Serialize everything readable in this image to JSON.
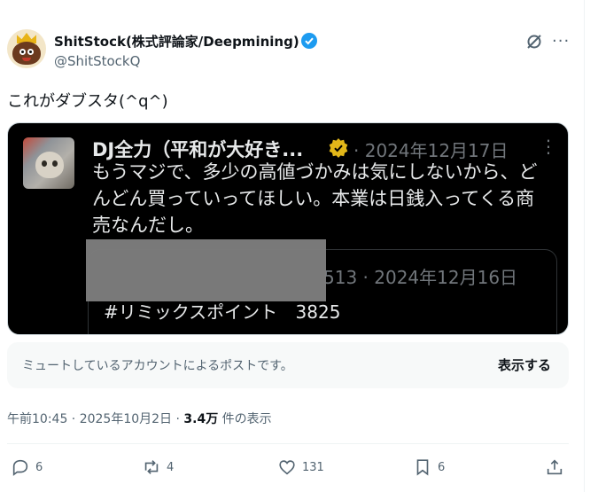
{
  "author": {
    "display_name": "ShitStock(株式評論家/Deepmining)",
    "handle": "@ShitStockQ",
    "verified": true
  },
  "tweet": {
    "text": "これがダブスタ(^q^)"
  },
  "media": {
    "inner_post": {
      "author": "DJ全力（平和が大好き...",
      "date": "· 2024年12月17日",
      "text": "もうマジで、多少の高値づかみは気にしないから、どんどん買っていってほしい。本業は日銭入ってくる商売なんだし。"
    },
    "quoted_post": {
      "date": "513 · 2024年12月16日",
      "text": "#リミックスポイント 3825"
    }
  },
  "notice": {
    "text": "ミュートしているアカウントによるポストです。",
    "button_label": "表示する"
  },
  "meta": {
    "timestamp": "午前10:45 · 2025年10月2日 · ",
    "views_count": "3.4万",
    "views_label": " 件の表示"
  },
  "actions": {
    "replies": "6",
    "reposts": "4",
    "likes": "131",
    "bookmarks": "6"
  },
  "colors": {
    "accent": "#1d9bf0",
    "muted_text": "#536471",
    "gold_badge": "#e2b719"
  },
  "icons": [
    "verified-icon",
    "grok-icon",
    "more-icon",
    "reply-icon",
    "repost-icon",
    "like-icon",
    "bookmark-icon",
    "share-icon"
  ]
}
